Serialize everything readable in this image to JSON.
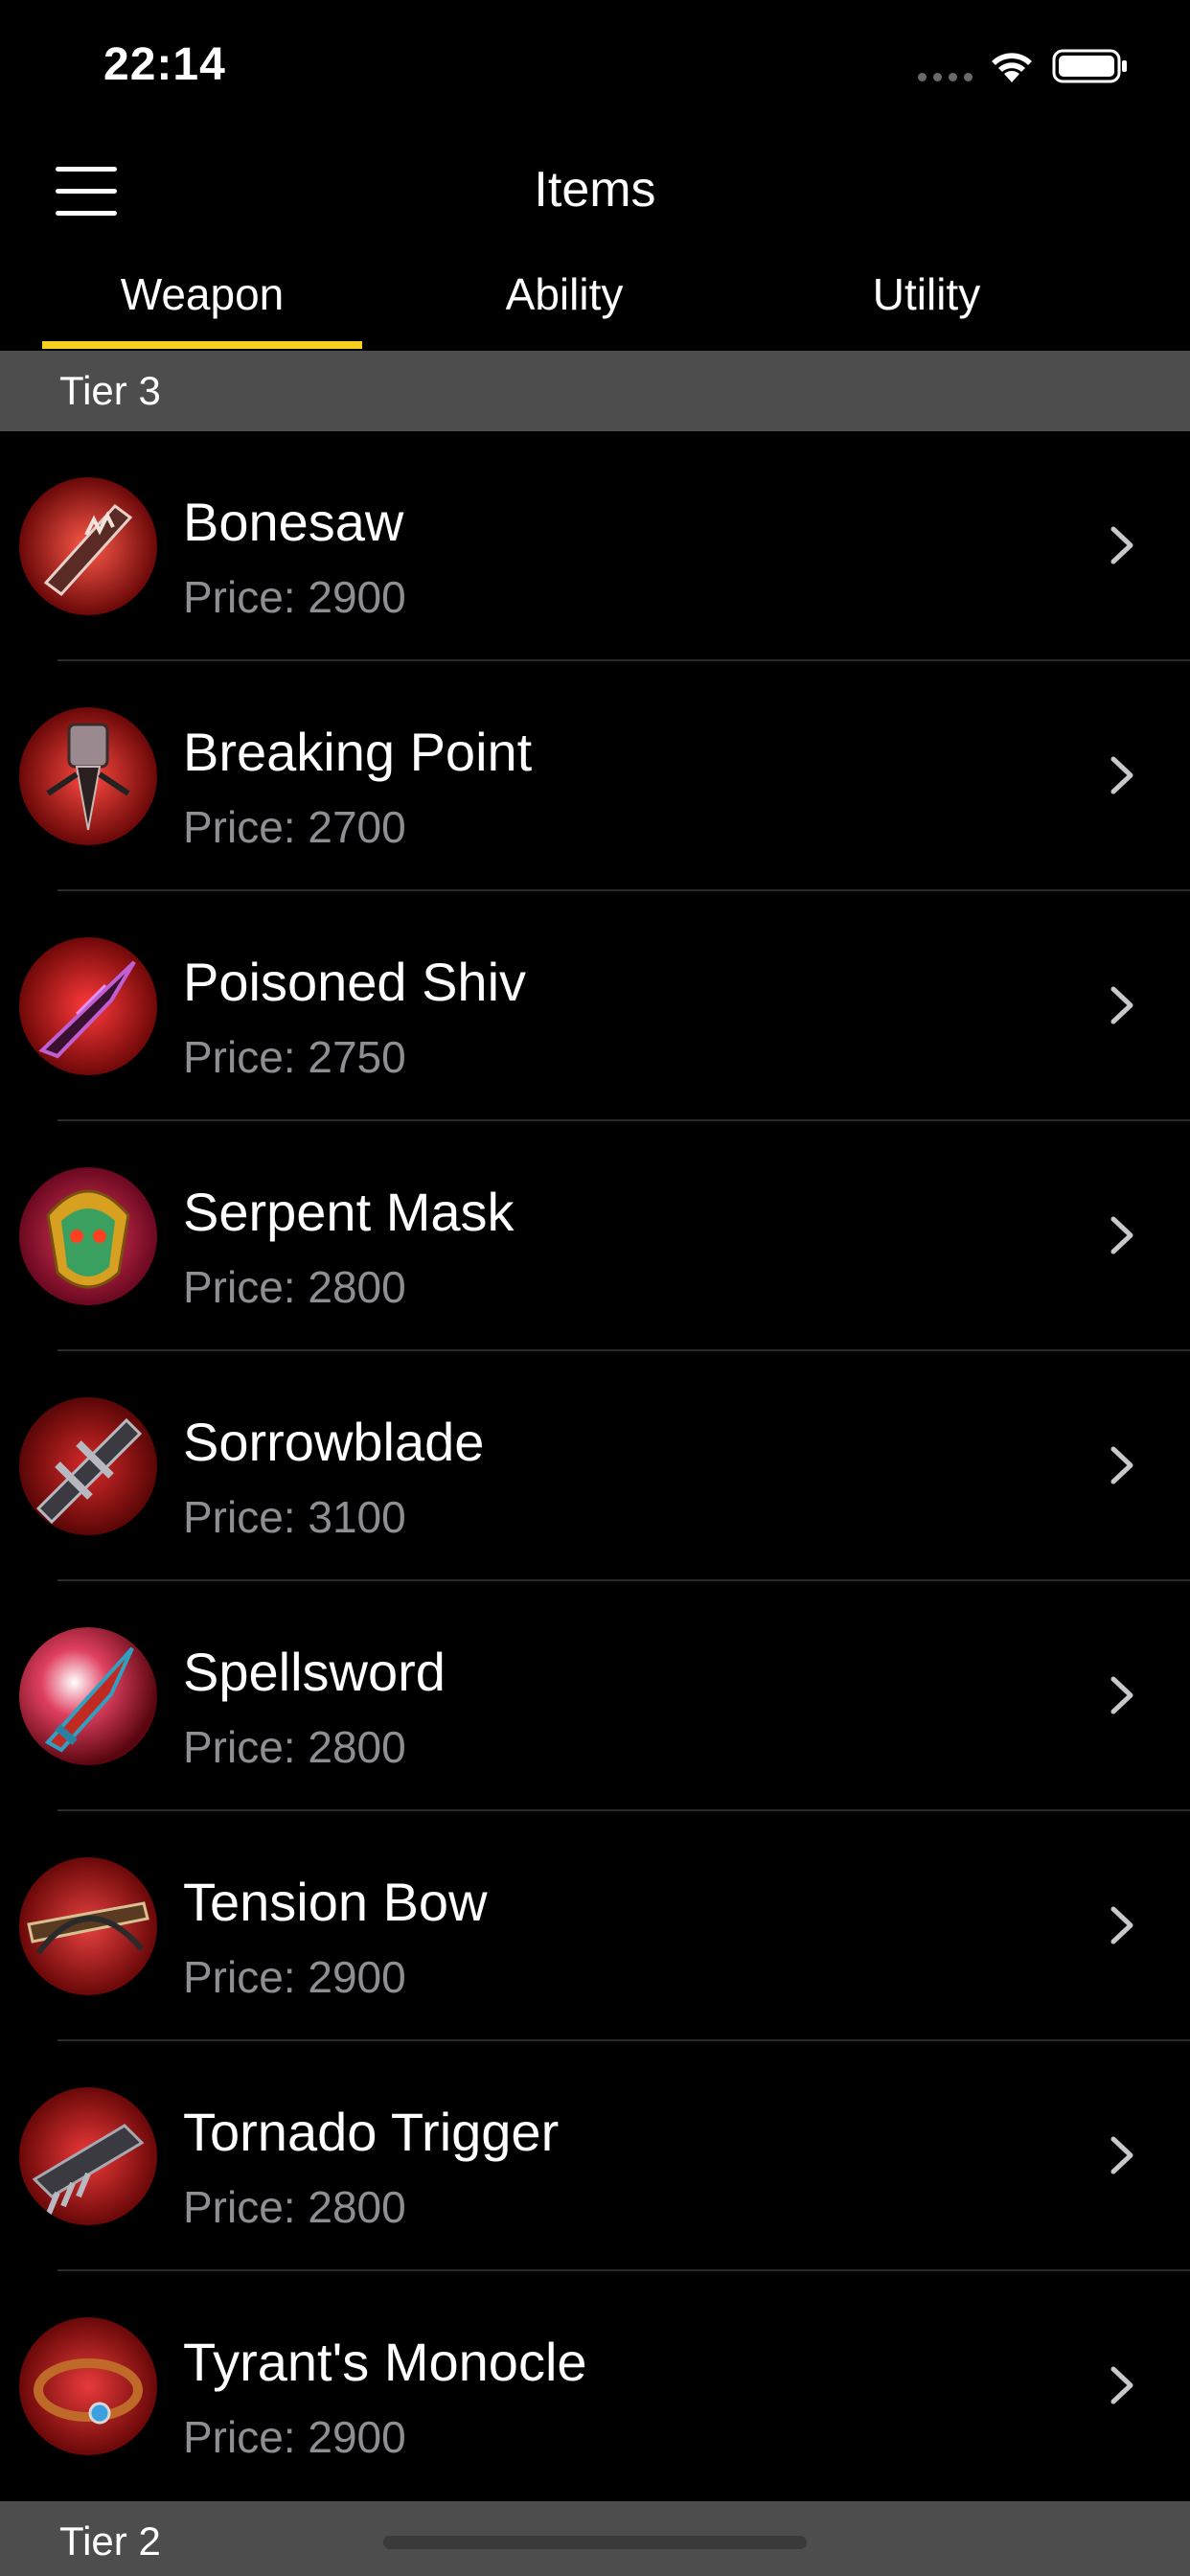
{
  "status_bar": {
    "time": "22:14"
  },
  "nav": {
    "title": "Items"
  },
  "tabs": [
    {
      "label": "Weapon",
      "selected": true
    },
    {
      "label": "Ability",
      "selected": false
    },
    {
      "label": "Utility",
      "selected": false
    }
  ],
  "accent_color": "#f7cf1f",
  "sections": [
    {
      "label": "Tier 3"
    },
    {
      "label": "Tier 2"
    }
  ],
  "items": [
    {
      "name": "Bonesaw",
      "price": "Price: 2900",
      "icon": "bonesaw-icon"
    },
    {
      "name": "Breaking Point",
      "price": "Price: 2700",
      "icon": "breaking-point-icon"
    },
    {
      "name": "Poisoned Shiv",
      "price": "Price: 2750",
      "icon": "poisoned-shiv-icon"
    },
    {
      "name": "Serpent Mask",
      "price": "Price: 2800",
      "icon": "serpent-mask-icon"
    },
    {
      "name": "Sorrowblade",
      "price": "Price: 3100",
      "icon": "sorrowblade-icon"
    },
    {
      "name": "Spellsword",
      "price": "Price: 2800",
      "icon": "spellsword-icon"
    },
    {
      "name": "Tension Bow",
      "price": "Price: 2900",
      "icon": "tension-bow-icon"
    },
    {
      "name": "Tornado Trigger",
      "price": "Price: 2800",
      "icon": "tornado-trigger-icon"
    },
    {
      "name": "Tyrant's Monocle",
      "price": "Price: 2900",
      "icon": "tyrants-monocle-icon"
    }
  ]
}
